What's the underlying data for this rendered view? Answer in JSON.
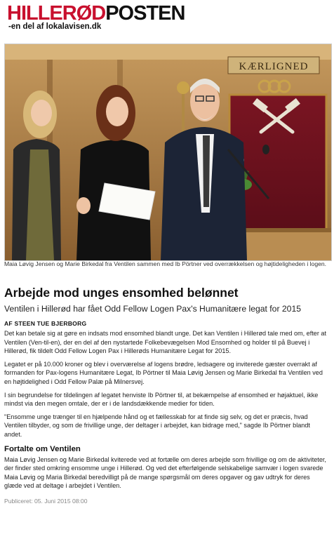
{
  "masthead": {
    "logo_part1": "HILLERØD",
    "logo_part2": "POSTEN",
    "tagline": "-en del af lokalavisen.dk"
  },
  "photo": {
    "sign_text": "KÆRLIGNED"
  },
  "caption": "Maia Løvig Jensen og Marie Birkedal fra Ventilen sammen med Ib Pörtner ved overrækkelsen og højtideligheden i logen.",
  "article": {
    "title": "Arbejde mod unges ensomhed belønnet",
    "subtitle": "Ventilen i Hillerød har fået Odd Fellow Logen Pax's Humanitære legat for 2015",
    "byline": "AF STEEN TUE BJERBORG",
    "paragraphs": [
      "Det kan betale sig at gøre en indsats mod ensomhed blandt unge. Det kan Ventilen i Hillerød tale med om, efter at Ventilen (Ven-til-en), der en del af den nystartede Folkebevægelsen Mod Ensomhed og holder til på Buevej i Hillerød, fik tildelt Odd Fellow Logen Pax i Hillerøds Humanitære Legat for 2015.",
      "Legatet er på 10.000 kroner og blev i overværelse af logens brødre, ledsagere og inviterede gæster overrakt af formanden for Pax-logens Humanitære Legat, Ib Pörtner til Maia Løvig Jensen og Marie Birkedal fra Ventilen ved en højtidelighed i Odd Fellow Palæ på Milnersvej.",
      "I sin begrundelse for tildelingen af legatet henviste Ib Pörtner til, at bekæmpelse af ensomhed er højaktuel, ikke mindst via den megen omtale, der er i de landsdækkende medier for tiden.",
      "\"Ensomme unge trænger til en hjælpende hånd og et fællesskab for at finde sig selv, og det er præcis, hvad Ventilen tilbyder, og som de frivillige unge, der deltager i arbejdet, kan bidrage med,\" sagde Ib Pörtner blandt andet."
    ],
    "section_heading": "Fortalte om Ventilen",
    "section_paragraph": "Maia Løvig Jensen og Marie Birkedal kviterede ved at fortælle om deres arbejde som frivillige og om de aktiviteter, der finder sted omkring ensomme unge i Hillerød. Og ved det efterfølgende selskabelige samvær i logen svarede Maia Løvig og Maria Birkedal beredvilligt på de mange spørgsmål om deres opgaver og gav udtryk for deres glæde ved at deltage i arbejdet i Ventilen.",
    "published": "Publiceret: 05. Juni 2015 08:00"
  },
  "colors": {
    "logo_red": "#c8102e",
    "text": "#1a1a1a",
    "muted": "#888888"
  }
}
